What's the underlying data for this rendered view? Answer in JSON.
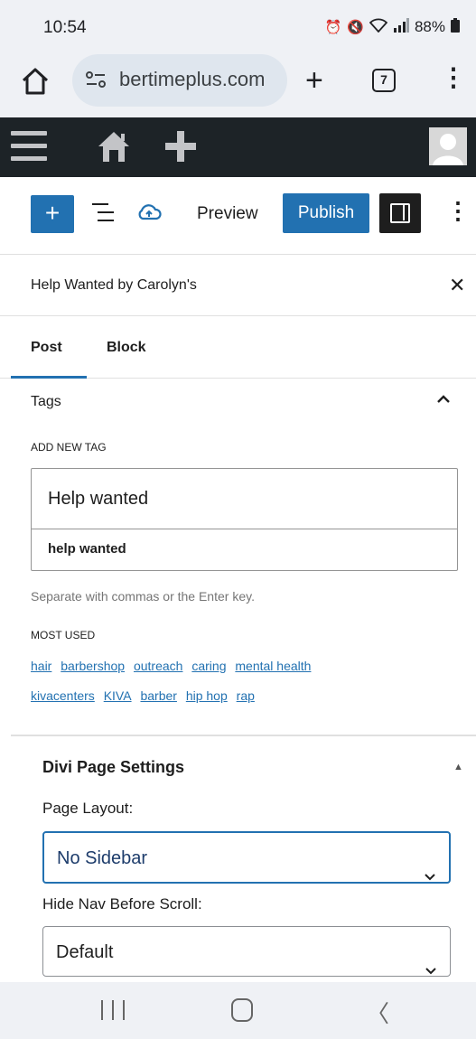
{
  "status": {
    "time": "10:54",
    "battery": "88%"
  },
  "browser": {
    "url": "bertimeplus.com",
    "tab_count": "7"
  },
  "toolbar": {
    "inserter_label": "+",
    "preview_label": "Preview",
    "publish_label": "Publish"
  },
  "sidebar": {
    "title": "Help Wanted by Carolyn's",
    "tabs": [
      "Post",
      "Block"
    ]
  },
  "tags": {
    "title": "Tags",
    "add_new_label": "ADD NEW TAG",
    "input_value": "Help wanted",
    "suggestion": "help wanted",
    "help_text": "Separate with commas or the Enter key.",
    "most_used_label": "MOST USED",
    "most_used": [
      "hair",
      "barbershop",
      "outreach",
      "caring",
      "mental health",
      "kivacenters",
      "KIVA",
      "barber",
      "hip hop",
      "rap"
    ]
  },
  "divi": {
    "title": "Divi Page Settings",
    "page_layout_label": "Page Layout:",
    "page_layout_value": "No Sidebar",
    "hide_nav_label": "Hide Nav Before Scroll:",
    "hide_nav_value": "Default"
  },
  "colors": {
    "accent": "#2271b1",
    "admin_bar": "#1d2327"
  }
}
